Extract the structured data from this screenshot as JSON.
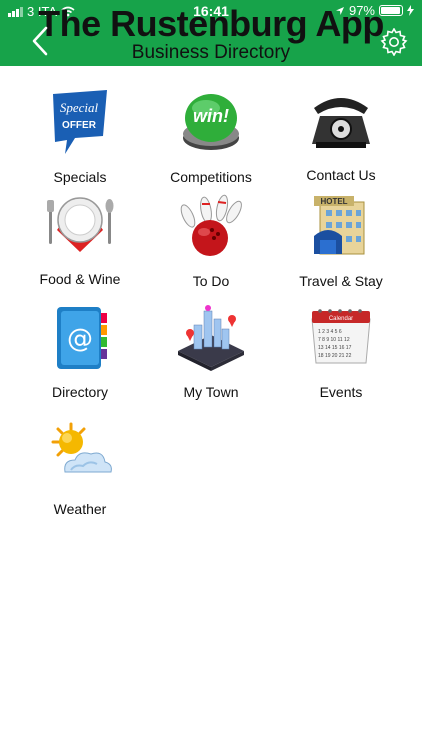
{
  "status_bar": {
    "carrier": "3 ITA",
    "time": "16:41",
    "battery": "97%"
  },
  "header": {
    "title": "The Rustenburg App",
    "subtitle": "Business Directory",
    "accent": "#17a34a"
  },
  "menu": [
    {
      "label": "Specials",
      "icon": "special-offer-icon"
    },
    {
      "label": "Competitions",
      "icon": "win-button-icon"
    },
    {
      "label": "Contact Us",
      "icon": "telephone-icon"
    },
    {
      "label": "Food & Wine",
      "icon": "plate-cutlery-icon"
    },
    {
      "label": "To Do",
      "icon": "bowling-icon"
    },
    {
      "label": "Travel & Stay",
      "icon": "hotel-icon"
    },
    {
      "label": "Directory",
      "icon": "address-book-icon"
    },
    {
      "label": "My Town",
      "icon": "city-map-icon"
    },
    {
      "label": "Events",
      "icon": "calendar-icon"
    },
    {
      "label": "Weather",
      "icon": "weather-icon"
    }
  ]
}
